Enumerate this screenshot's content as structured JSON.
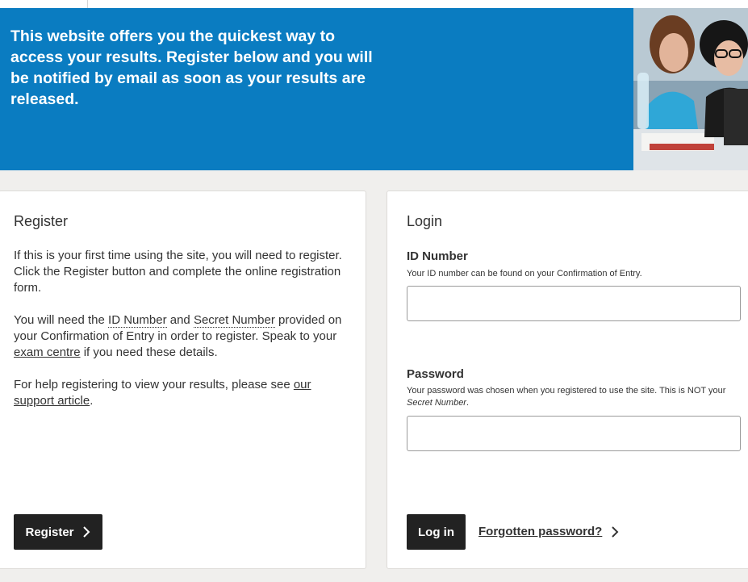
{
  "banner": {
    "text": "This website offers you the quickest way to access your results. Register below and you will be notified by email as soon as your results are released.",
    "background": "#0a7cc1"
  },
  "register": {
    "title": "Register",
    "p1": "If this is your first time using the site, you will need to register. Click the Register button and complete the online registration form.",
    "p2_a": "You will need the ",
    "p2_id": "ID Number",
    "p2_b": " and ",
    "p2_secret": "Secret Number",
    "p2_c": " provided on your Confirmation of Entry in order to register. Speak to your ",
    "p2_link": "exam centre",
    "p2_d": " if you need these details.",
    "p3_a": "For help registering to view your results, please see ",
    "p3_link": "our support article",
    "p3_b": ".",
    "button_label": "Register"
  },
  "login": {
    "title": "Login",
    "id_label": "ID Number",
    "id_help": "Your ID number can be found on your Confirmation of Entry.",
    "id_value": "",
    "password_label": "Password",
    "password_help_a": "Your password was chosen when you registered to use the site. This is NOT your ",
    "password_help_em": "Secret Number",
    "password_help_b": ".",
    "password_value": "",
    "button_label": "Log in",
    "forgot_label": "Forgotten password?"
  },
  "icons": {
    "chevron": "chevron-right-icon"
  }
}
